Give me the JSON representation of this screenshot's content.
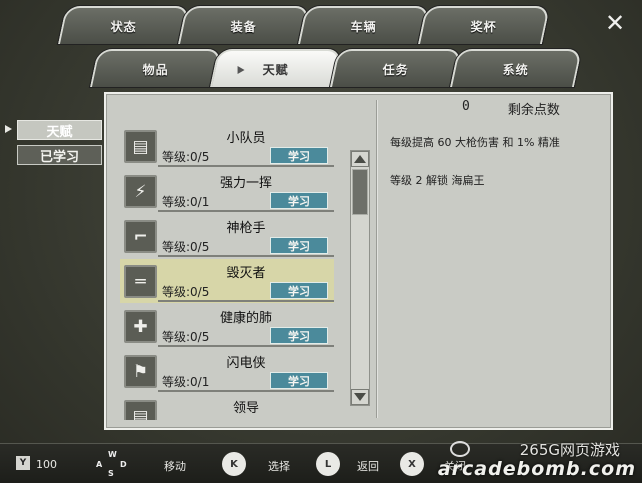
{
  "tabs_top": [
    {
      "label": "状态"
    },
    {
      "label": "装备"
    },
    {
      "label": "车辆"
    },
    {
      "label": "奖杯"
    }
  ],
  "tabs_bottom": [
    {
      "label": "物品"
    },
    {
      "label": "天赋",
      "active": true
    },
    {
      "label": "任务"
    },
    {
      "label": "系统"
    }
  ],
  "close_icon": "close-icon",
  "sidenav": [
    {
      "label": "天赋",
      "active": true
    },
    {
      "label": "已学习"
    }
  ],
  "points": {
    "value": "0",
    "label": "剩余点数"
  },
  "description": {
    "line1": "每级提高 60 大枪伤害 和 1% 精准",
    "line2": "等级 2 解锁 海扁王"
  },
  "skills": [
    {
      "name": "小队员",
      "level": "等级:0/5",
      "button": "学习",
      "icon": "squad-icon",
      "glyph": "▤"
    },
    {
      "name": "强力一挥",
      "level": "等级:0/1",
      "button": "学习",
      "icon": "slash-icon",
      "glyph": "⚡"
    },
    {
      "name": "神枪手",
      "level": "等级:0/5",
      "button": "学习",
      "icon": "pistol-icon",
      "glyph": "⌐"
    },
    {
      "name": "毁灭者",
      "level": "等级:0/5",
      "button": "学习",
      "icon": "rifle-icon",
      "glyph": "═"
    },
    {
      "name": "健康的肺",
      "level": "等级:0/5",
      "button": "学习",
      "icon": "health-cross-icon",
      "glyph": "✚"
    },
    {
      "name": "闪电侠",
      "level": "等级:0/1",
      "button": "学习",
      "icon": "runner-icon",
      "glyph": "⚑"
    },
    {
      "name": "领导",
      "icon": "leader-icon",
      "glyph": "▤"
    }
  ],
  "bottombar": {
    "y_key": "Y",
    "y_value": "100",
    "dpad": {
      "up": "W",
      "left": "A",
      "down": "S",
      "right": "D"
    },
    "move": "移动",
    "k_key": "K",
    "select": "选择",
    "l_key": "L",
    "back": "返回",
    "x_key": "X",
    "close": "关闭"
  },
  "watermark": {
    "line1": "265G网页游戏",
    "line2": "arcadebomb.com"
  }
}
